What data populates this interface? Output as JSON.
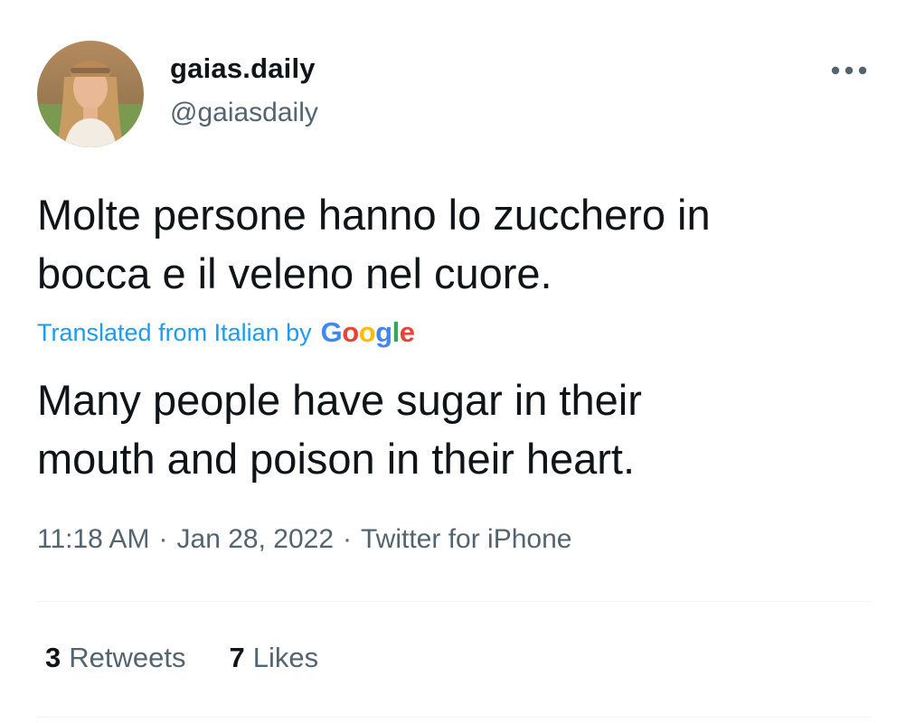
{
  "author": {
    "display_name": "gaias.daily",
    "handle": "@gaiasdaily",
    "avatar_icon": "profile-photo"
  },
  "more_icon": "more-horizontal-icon",
  "tweet": {
    "text_line1": "Molte persone hanno lo zucchero in",
    "text_line2": "bocca e il veleno nel cuore.",
    "translation_label": "Translated from Italian by",
    "translation_provider": {
      "letters": [
        "G",
        "o",
        "o",
        "g",
        "l",
        "e"
      ],
      "colors": [
        "#4285f4",
        "#ea4335",
        "#fbbc05",
        "#4285f4",
        "#34a853",
        "#ea4335"
      ]
    },
    "translated_line1": "Many people have sugar in their",
    "translated_line2": "mouth and poison in their heart."
  },
  "meta": {
    "time": "11:18 AM",
    "separator": "·",
    "date": "Jan 28, 2022",
    "source": "Twitter for iPhone"
  },
  "stats": {
    "retweets_count": "3",
    "retweets_label": "Retweets",
    "likes_count": "7",
    "likes_label": "Likes"
  },
  "colors": {
    "link_blue": "#1d9bf0",
    "secondary_text": "#536471",
    "primary_text": "#0f1419",
    "divider": "#eff3f4"
  }
}
